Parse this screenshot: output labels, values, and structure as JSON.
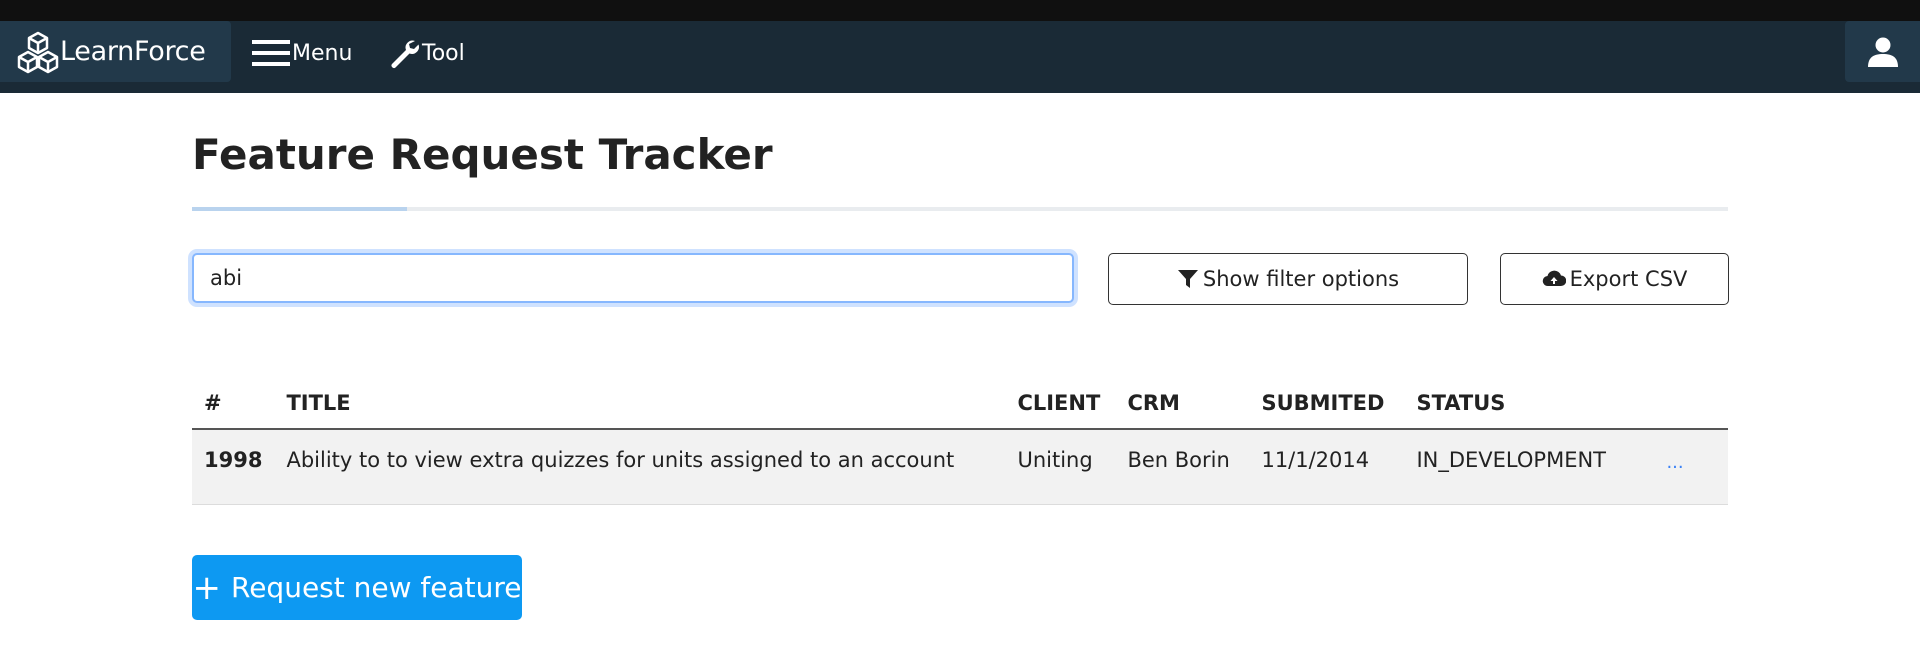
{
  "navbar": {
    "brand": "LearnForce",
    "menu_label": "Menu",
    "tool_label": "Tool",
    "icons": {
      "logo": "cubes-icon",
      "menu": "hamburger-icon",
      "tool": "wrench-icon",
      "user": "user-icon"
    },
    "colors": {
      "bar": "#1a2a36",
      "item": "#22394a",
      "top_strip": "#101010"
    }
  },
  "page": {
    "title": "Feature Request Tracker"
  },
  "search": {
    "value": "abi"
  },
  "toolbar": {
    "filter_label": "Show filter options",
    "filter_icon": "funnel-icon",
    "export_label": "Export CSV",
    "export_icon": "cloud-upload-icon"
  },
  "table": {
    "headers": [
      "#",
      "TITLE",
      "CLIENT",
      "CRM",
      "SUBMITED",
      "STATUS"
    ],
    "rows": [
      {
        "id": "1998",
        "title": "Ability to to view extra quizzes for units assigned to an account",
        "client": "Uniting",
        "crm": "Ben Borin",
        "submitted": "11/1/2014",
        "status": "IN_DEVELOPMENT",
        "more": "..."
      }
    ]
  },
  "actions": {
    "request_label": "Request new feature",
    "request_icon": "plus-icon",
    "accent": "#0d99f2"
  }
}
